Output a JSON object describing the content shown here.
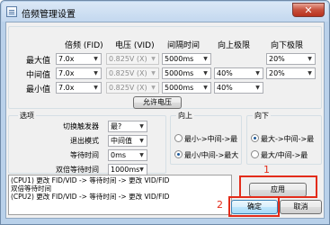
{
  "window": {
    "title": "倍频管理设置",
    "close_glyph": "✕"
  },
  "table": {
    "headers": [
      "倍频 (FID)",
      "电压 (VID)",
      "间隔时间",
      "向上极限",
      "向下极限"
    ],
    "rows": [
      {
        "label": "最大值",
        "fid": "7.0x",
        "vid": "0.825V (X)",
        "interval": "5000ms",
        "up": "",
        "down": "20%"
      },
      {
        "label": "中间值",
        "fid": "7.0x",
        "vid": "0.825V (X)",
        "interval": "5000ms",
        "up": "40%",
        "down": "20%"
      },
      {
        "label": "最小值",
        "fid": "7.0x",
        "vid": "0.825V (X)",
        "interval": "5000ms",
        "up": "40%",
        "down": ""
      }
    ]
  },
  "allow_voltage_button": "允许电压",
  "options": {
    "title": "选项",
    "trigger_label": "切换触发器",
    "trigger_value": "最?",
    "exit_label": "退出模式",
    "exit_value": "中间值",
    "wait_label": "等待时间",
    "wait_value": "0ms",
    "double_wait_label": "双倍等待时间",
    "double_wait_value": "1000ms"
  },
  "up_group": {
    "title": "向上",
    "option1": "最小->中间->最",
    "option2": "最小/中间->最大",
    "selected": 2
  },
  "down_group": {
    "title": "向下",
    "option1": "最大->中间->最",
    "option2": "最大/中间->最",
    "selected": 1
  },
  "status_lines": [
    "(CPU1) 更改 FID/VID -> 等待时间 -> 更改 VID/FID",
    " 双倍等待时间",
    "(CPU2) 更改 FID/VID -> 等待时间 -> 更改 VID/FID"
  ],
  "buttons": {
    "apply": "应用",
    "ok": "确定",
    "cancel": "取消"
  },
  "annotations": {
    "marker1": "1",
    "marker2": "2",
    "color": "#e32c1a"
  }
}
